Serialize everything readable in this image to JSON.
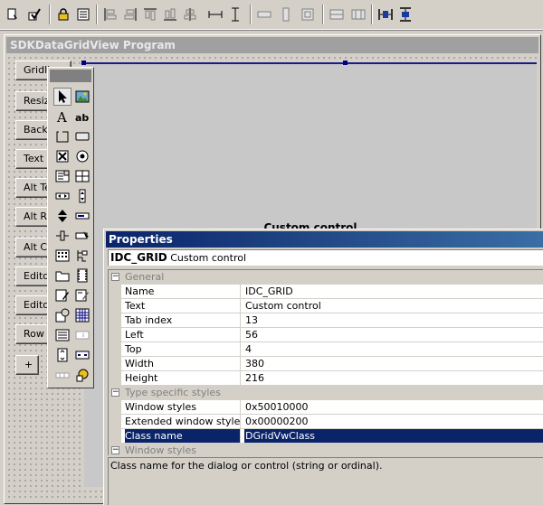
{
  "toolbar": {
    "buttons": [
      {
        "icon": "test-dialog-icon"
      },
      {
        "icon": "check-mnemonics-icon"
      },
      {
        "icon": "lock-icon"
      },
      {
        "icon": "tab-order-icon"
      },
      {
        "icon": "align-left-icon"
      },
      {
        "icon": "align-right-icon"
      },
      {
        "icon": "align-top-icon"
      },
      {
        "icon": "align-bottom-icon"
      },
      {
        "icon": "align-center-icon"
      },
      {
        "icon": "space-across-icon"
      },
      {
        "icon": "space-down-icon"
      },
      {
        "icon": "same-width-icon"
      },
      {
        "icon": "same-height-icon"
      },
      {
        "icon": "same-size-icon"
      },
      {
        "icon": "toggle-grid-icon"
      },
      {
        "icon": "toggle-guides-icon"
      },
      {
        "icon": "center-horizontal-icon"
      },
      {
        "icon": "center-vertical-icon"
      }
    ]
  },
  "dialog": {
    "title": "SDKDataGridView Program",
    "buttons": [
      "Gridli",
      "Resize",
      "Back",
      "Text",
      "Alt Te",
      "Alt Ro",
      "Alt Co",
      "Edito",
      "Editor T",
      "Row He",
      "+"
    ],
    "custom_control_label": "Custom control"
  },
  "toolbox": {
    "tools": [
      "pointer-icon",
      "picture-control-icon",
      "static-text-icon",
      "edit-box-icon",
      "group-box-icon",
      "button-icon",
      "checkbox-icon",
      "radio-button-icon",
      "combo-box-icon",
      "list-box-icon",
      "horizontal-scrollbar-icon",
      "vertical-scrollbar-icon",
      "spin-control-icon",
      "progress-bar-icon",
      "slider-icon",
      "hotkey-icon",
      "list-control-icon",
      "tree-control-icon",
      "tab-control-icon",
      "animation-icon",
      "rich-edit-icon",
      "date-time-picker-icon",
      "month-calendar-icon",
      "ip-address-icon",
      "custom-control-icon",
      "extended-combo-icon",
      "syslink-icon",
      "split-button-icon",
      "network-address-icon",
      "command-button-icon"
    ]
  },
  "properties": {
    "title": "Properties",
    "header_id": "IDC_GRID",
    "header_type": "Custom control",
    "categories": {
      "general": "General",
      "type_specific": "Type specific styles",
      "window_styles": "Window styles"
    },
    "general_rows": [
      {
        "name": "Name",
        "value": "IDC_GRID"
      },
      {
        "name": "Text",
        "value": "Custom control"
      },
      {
        "name": "Tab index",
        "value": "13"
      },
      {
        "name": "Left",
        "value": "56"
      },
      {
        "name": "Top",
        "value": "4"
      },
      {
        "name": "Width",
        "value": "380"
      },
      {
        "name": "Height",
        "value": "216"
      }
    ],
    "type_rows": [
      {
        "name": "Window styles",
        "value": "0x50010000"
      },
      {
        "name": "Extended window styles",
        "value": "0x00000200"
      },
      {
        "name": "Class name",
        "value": "DGridVwClass"
      }
    ],
    "selected_row": "Class name",
    "description": "Class name for the dialog or control (string or ordinal)."
  }
}
